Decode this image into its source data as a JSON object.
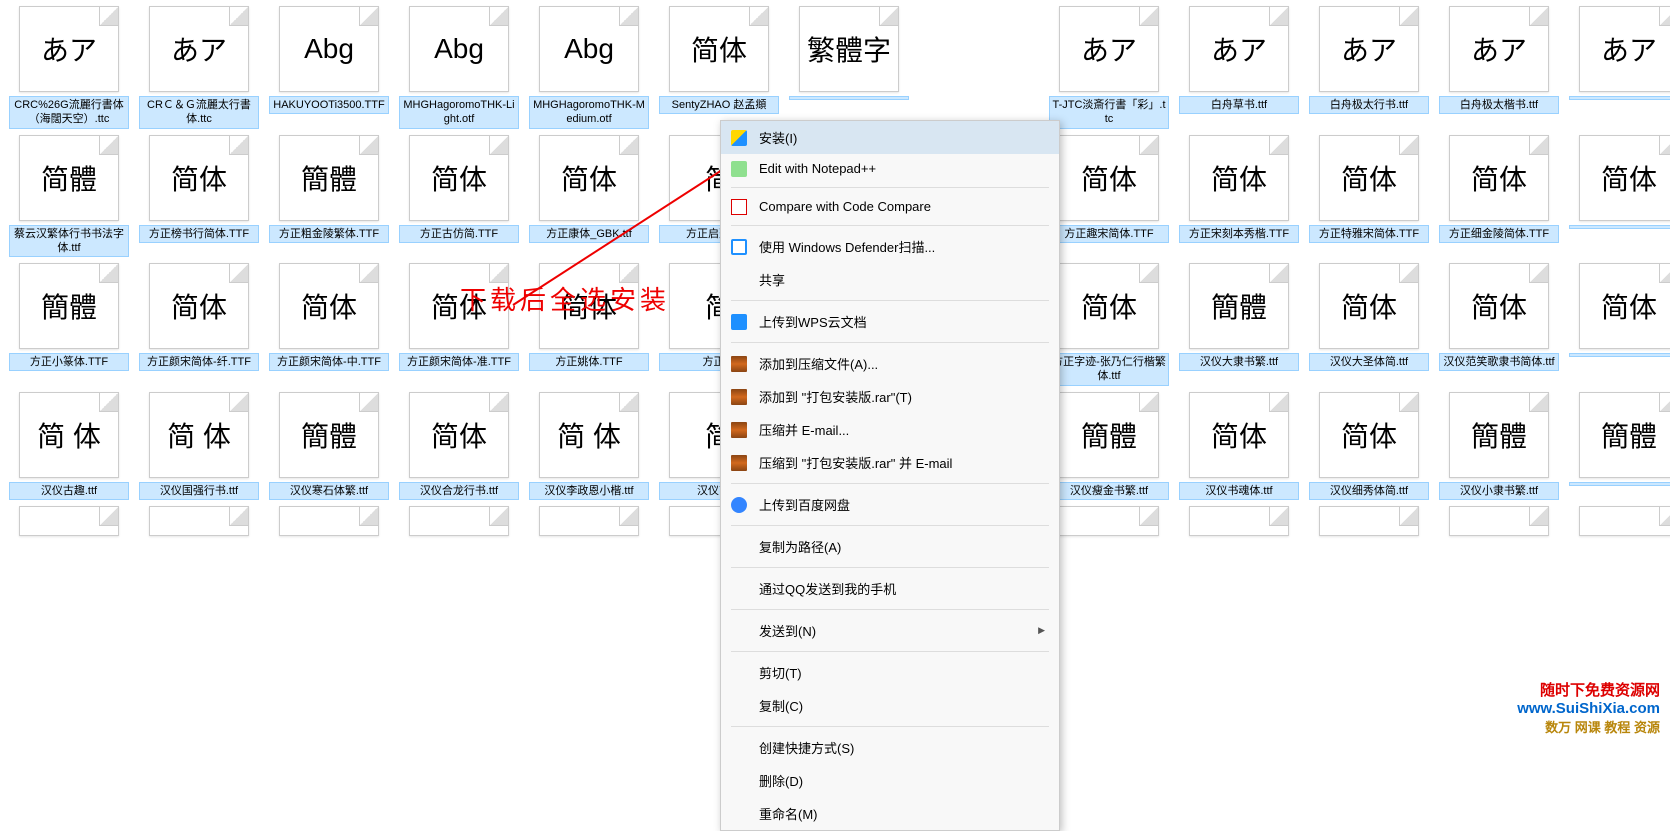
{
  "annotation_text": "下载后全选安装",
  "watermark": {
    "line1": "随时下免费资源网",
    "line2": "www.SuiShiXia.com",
    "line3": "数万 网课 教程 资源"
  },
  "context_menu": {
    "items": [
      {
        "label": "安装(I)",
        "icon": "shield-icon",
        "iconClass": "icon-shield",
        "hover": true
      },
      {
        "label": "Edit with Notepad++",
        "icon": "edit-icon",
        "iconClass": "icon-np"
      },
      {
        "sep": true
      },
      {
        "label": "Compare with Code Compare",
        "icon": "compare-icon",
        "iconClass": "icon-cmp"
      },
      {
        "sep": true
      },
      {
        "label": "使用 Windows Defender扫描...",
        "icon": "defender-icon",
        "iconClass": "icon-def"
      },
      {
        "label": "共享",
        "icon": "share-icon",
        "iconClass": "icon-share"
      },
      {
        "sep": true
      },
      {
        "label": "上传到WPS云文档",
        "icon": "wps-icon",
        "iconClass": "icon-wps"
      },
      {
        "sep": true
      },
      {
        "label": "添加到压缩文件(A)...",
        "icon": "archive-icon",
        "iconClass": "icon-rar"
      },
      {
        "label": "添加到 \"打包安装版.rar\"(T)",
        "icon": "archive-icon",
        "iconClass": "icon-rar"
      },
      {
        "label": "压缩并 E-mail...",
        "icon": "archive-icon",
        "iconClass": "icon-rar"
      },
      {
        "label": "压缩到 \"打包安装版.rar\" 并 E-mail",
        "icon": "archive-icon",
        "iconClass": "icon-rar"
      },
      {
        "sep": true
      },
      {
        "label": "上传到百度网盘",
        "icon": "baidu-icon",
        "iconClass": "icon-baidu"
      },
      {
        "sep": true
      },
      {
        "label": "复制为路径(A)"
      },
      {
        "sep": true
      },
      {
        "label": "通过QQ发送到我的手机"
      },
      {
        "sep": true
      },
      {
        "label": "发送到(N)",
        "arrow": true
      },
      {
        "sep": true
      },
      {
        "label": "剪切(T)"
      },
      {
        "label": "复制(C)"
      },
      {
        "sep": true
      },
      {
        "label": "创建快捷方式(S)"
      },
      {
        "label": "删除(D)"
      },
      {
        "label": "重命名(M)"
      }
    ]
  },
  "files": {
    "row1": [
      {
        "preview": "あア",
        "name": "CRC%26G流麗行書体（海闊天空）.ttc"
      },
      {
        "preview": "あア",
        "name": "CRＣ＆Ｇ流麗太行書体.ttc"
      },
      {
        "preview": "Abg",
        "name": "HAKUYOOTi3500.TTF"
      },
      {
        "preview": "Abg",
        "name": "MHGHagoromoTHK-Light.otf"
      },
      {
        "preview": "Abg",
        "name": "MHGHagoromoTHK-Medium.otf"
      },
      {
        "preview": "简体",
        "name": "SentyZHAO 赵孟頫"
      },
      {
        "preview": "繁體字",
        "name": ""
      },
      {
        "preview": "あア",
        "name": ""
      },
      {
        "preview": "あア",
        "name": "T-JTC淡斎行書「彩」.ttc"
      },
      {
        "preview": "あア",
        "name": "白舟草书.ttf"
      },
      {
        "preview": "あア",
        "name": "白舟极太行书.ttf"
      },
      {
        "preview": "あア",
        "name": "白舟极太楷书.ttf"
      },
      {
        "preview": "あア",
        "name": ""
      }
    ],
    "row2": [
      {
        "preview": "简體",
        "name": "蔡云汉繁体行书书法字体.ttf"
      },
      {
        "preview": "简体",
        "name": "方正榜书行简体.TTF"
      },
      {
        "preview": "簡體",
        "name": "方正粗金陵繁体.TTF"
      },
      {
        "preview": "简体",
        "name": "方正古仿简.TTF"
      },
      {
        "preview": "简体",
        "name": "方正康体_GBK.ttf"
      },
      {
        "preview": "简",
        "name": "方正启建简体"
      },
      {
        "preview": "",
        "name": ""
      },
      {
        "preview": "",
        "name": ""
      },
      {
        "preview": "简体",
        "name": "方正趣宋简体.TTF"
      },
      {
        "preview": "简体",
        "name": "方正宋刻本秀楷.TTF"
      },
      {
        "preview": "简体",
        "name": "方正特雅宋简体.TTF"
      },
      {
        "preview": "简体",
        "name": "方正细金陵简体.TTF"
      },
      {
        "preview": "简体",
        "name": ""
      }
    ],
    "row3": [
      {
        "preview": "簡體",
        "name": "方正小篆体.TTF"
      },
      {
        "preview": "简体",
        "name": "方正颜宋简体-纤.TTF"
      },
      {
        "preview": "简体",
        "name": "方正颜宋简体-中.TTF"
      },
      {
        "preview": "简体",
        "name": "方正颜宋简体-准.TTF"
      },
      {
        "preview": "简体",
        "name": "方正姚体.TTF"
      },
      {
        "preview": "简",
        "name": "方正蕾"
      },
      {
        "preview": "",
        "name": ""
      },
      {
        "preview": "",
        "name": ""
      },
      {
        "preview": "简体",
        "name": "方正字迹-张乃仁行楷繁体.ttf"
      },
      {
        "preview": "簡體",
        "name": "汉仪大隶书繁.ttf"
      },
      {
        "preview": "简体",
        "name": "汉仪大圣体简.ttf"
      },
      {
        "preview": "简体",
        "name": "汉仪范笑歌隶书简体.ttf"
      },
      {
        "preview": "简体",
        "name": ""
      }
    ],
    "row4": [
      {
        "preview": "简 体",
        "name": "汉仪古趣.ttf"
      },
      {
        "preview": "简 体",
        "name": "汉仪国强行书.ttf"
      },
      {
        "preview": "簡體",
        "name": "汉仪寒石体繁.ttf"
      },
      {
        "preview": "简体",
        "name": "汉仪合龙行书.ttf"
      },
      {
        "preview": "简 体",
        "name": "汉仪李政恩小楷.ttf"
      },
      {
        "preview": "简",
        "name": "汉仪南宫"
      },
      {
        "preview": "",
        "name": ""
      },
      {
        "preview": "",
        "name": ""
      },
      {
        "preview": "簡體",
        "name": "汉仪瘦金书繁.ttf"
      },
      {
        "preview": "简体",
        "name": "汉仪书魂体.ttf"
      },
      {
        "preview": "简体",
        "name": "汉仪细秀体简.ttf"
      },
      {
        "preview": "簡體",
        "name": "汉仪小隶书繁.ttf"
      },
      {
        "preview": "簡體",
        "name": ""
      }
    ]
  }
}
